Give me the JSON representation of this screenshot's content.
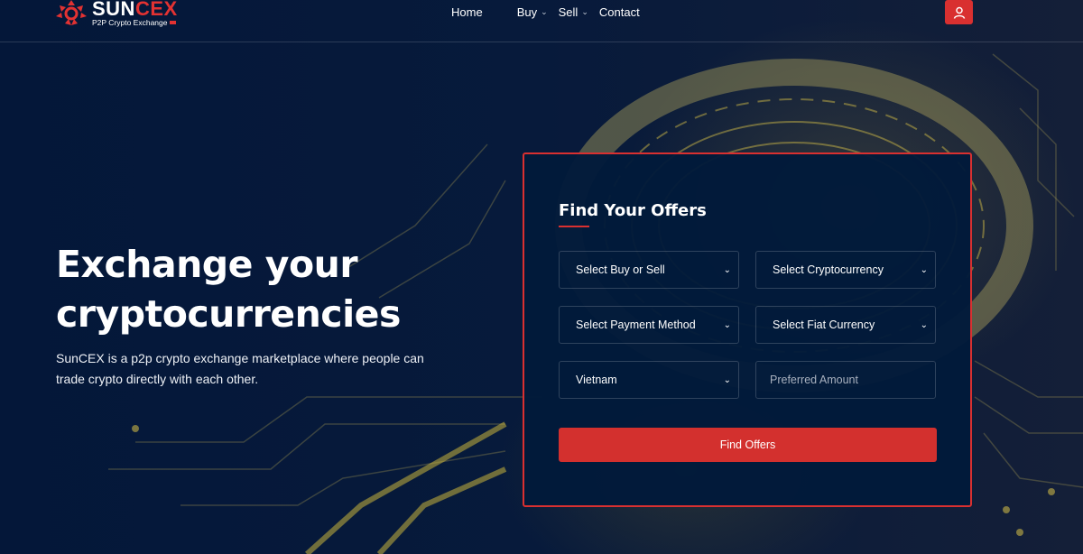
{
  "brand": {
    "name_white": "SUN",
    "name_red": "CEX",
    "tagline": "P2P Crypto Exchange",
    "accent_color": "#d93030",
    "bg_color": "#041739"
  },
  "nav": {
    "items": [
      {
        "label": "Home",
        "has_dropdown": false
      },
      {
        "label": "Buy",
        "has_dropdown": true
      },
      {
        "label": "Sell",
        "has_dropdown": true
      },
      {
        "label": "Contact",
        "has_dropdown": false
      }
    ],
    "user_icon": "user-icon"
  },
  "hero": {
    "title_line1": "Exchange your",
    "title_line2": "cryptocurrencies",
    "description": "SunCEX is a p2p crypto exchange marketplace where people can trade crypto directly with each other."
  },
  "form": {
    "title": "Find Your Offers",
    "buy_sell": {
      "value": "Select Buy or Sell"
    },
    "cryptocurrency": {
      "value": "Select Cryptocurrency"
    },
    "payment_method": {
      "value": "Select Payment Method"
    },
    "fiat_currency": {
      "value": "Select Fiat Currency"
    },
    "country": {
      "value": "Vietnam"
    },
    "amount": {
      "value": "",
      "placeholder": "Preferred Amount"
    },
    "submit_label": "Find Offers"
  }
}
